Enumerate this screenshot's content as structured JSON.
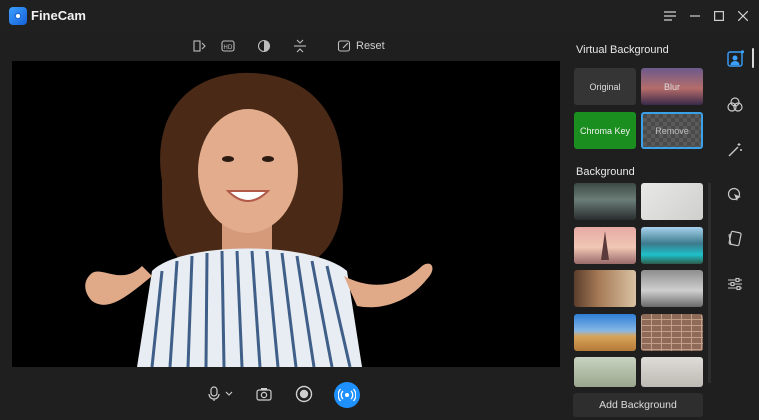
{
  "app": {
    "title": "FineCam"
  },
  "toolbar": {
    "reset_label": "Reset"
  },
  "virtual_background": {
    "title": "Virtual Background",
    "options": [
      {
        "label": "Original"
      },
      {
        "label": "Blur"
      },
      {
        "label": "Chroma Key"
      },
      {
        "label": "Remove"
      }
    ]
  },
  "background": {
    "title": "Background",
    "add_label": "Add Background"
  },
  "colors": {
    "accent": "#1e90ff",
    "chroma_green": "#1a8f1f",
    "selected_border": "#3ca0e6"
  }
}
